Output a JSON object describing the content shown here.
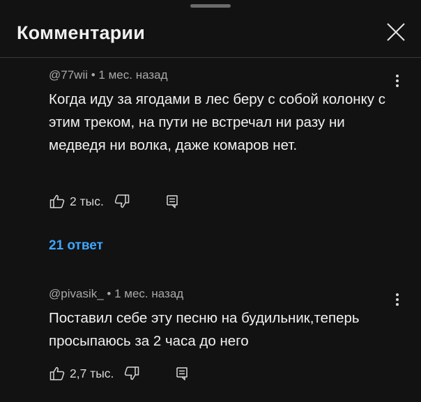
{
  "header": {
    "title": "Комментарии"
  },
  "comments": [
    {
      "author": "@77wii",
      "time": "1 мес. назад",
      "text": "Когда иду за ягодами в лес беру с собой колонку с этим треком, на пути не встречал ни разу ни медведя ни волка, даже комаров нет.",
      "likes": "2 тыс.",
      "replies_label": "21 ответ"
    },
    {
      "author": "@pivasik_",
      "time": "1 мес. назад",
      "text": "Поставил себе эту песню на будильник,теперь просыпаюсь за 2 часа до него",
      "likes": "2,7 тыс."
    }
  ],
  "icons": {
    "close": "close-icon",
    "more": "more-vertical-icon",
    "like": "thumbs-up-icon",
    "dislike": "thumbs-down-icon",
    "reply": "reply-icon"
  },
  "colors": {
    "background": "#121212",
    "text": "#f1f1f1",
    "meta": "#a9a9a9",
    "link": "#3ea6ff"
  }
}
